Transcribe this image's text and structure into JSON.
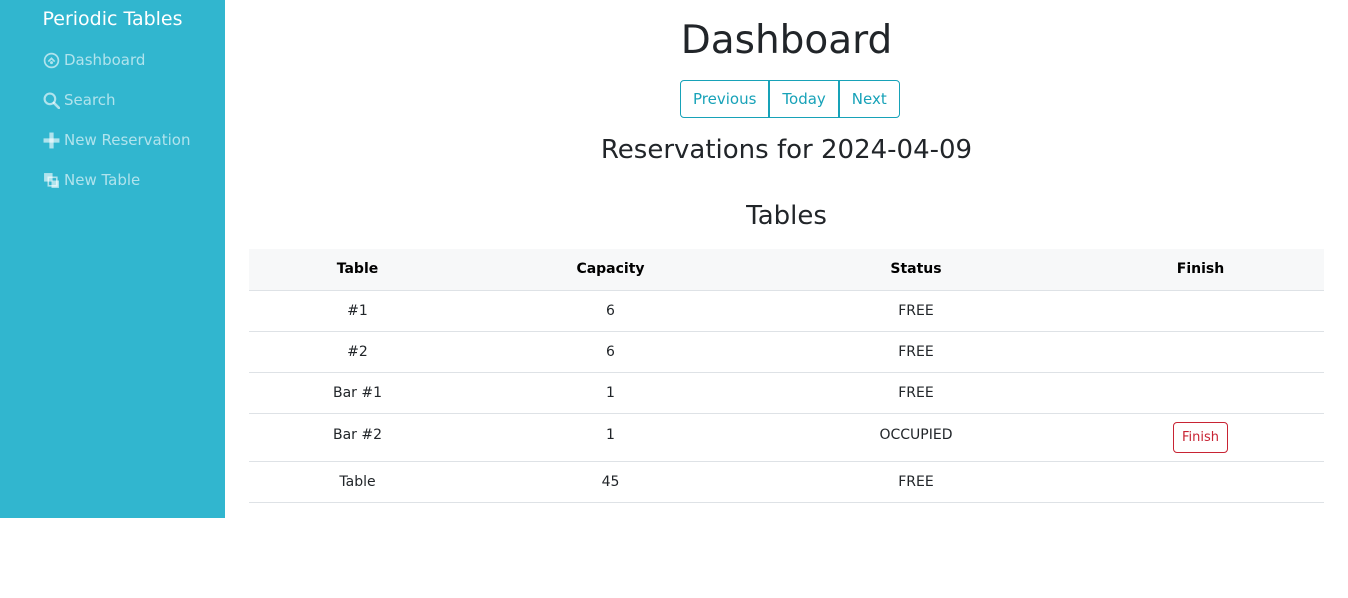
{
  "sidebar": {
    "brand": "Periodic Tables",
    "items": [
      {
        "label": "Dashboard",
        "icon": "dashboard-icon"
      },
      {
        "label": "Search",
        "icon": "search-icon"
      },
      {
        "label": "New Reservation",
        "icon": "plus-icon"
      },
      {
        "label": "New Table",
        "icon": "layers-icon"
      }
    ]
  },
  "main": {
    "title": "Dashboard",
    "nav_buttons": {
      "previous": "Previous",
      "today": "Today",
      "next": "Next"
    },
    "reservations_heading": "Reservations for 2024-04-09",
    "tables_heading": "Tables"
  },
  "tables": {
    "headers": [
      "Table",
      "Capacity",
      "Status",
      "Finish"
    ],
    "rows": [
      {
        "name": "#1",
        "capacity": "6",
        "status": "FREE",
        "finish": ""
      },
      {
        "name": "#2",
        "capacity": "6",
        "status": "FREE",
        "finish": ""
      },
      {
        "name": "Bar #1",
        "capacity": "1",
        "status": "FREE",
        "finish": ""
      },
      {
        "name": "Bar #2",
        "capacity": "1",
        "status": "OCCUPIED",
        "finish": "Finish"
      },
      {
        "name": "Table",
        "capacity": "45",
        "status": "FREE",
        "finish": ""
      }
    ]
  },
  "colors": {
    "sidebar": "#31b6cf",
    "info": "#17a2b8",
    "danger": "#c82333"
  }
}
